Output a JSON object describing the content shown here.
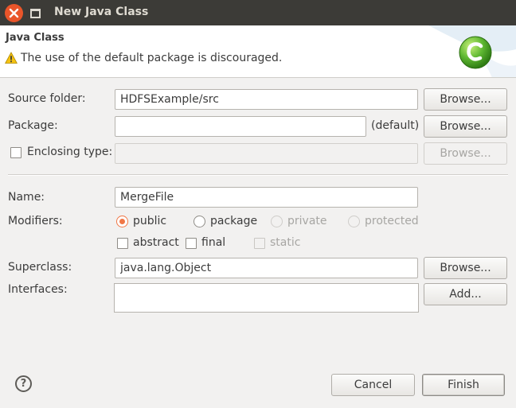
{
  "window": {
    "title": "New Java Class"
  },
  "header": {
    "title": "Java Class",
    "message": "The use of the default package is discouraged.",
    "icon": "java-class-logo-icon",
    "accent": "#5fb832"
  },
  "form": {
    "source_folder": {
      "label": "Source folder:",
      "value": "HDFSExample/src",
      "browse_label": "Browse..."
    },
    "package": {
      "label": "Package:",
      "value": "",
      "suffix": "(default)",
      "browse_label": "Browse..."
    },
    "enclosing_type": {
      "label": "Enclosing type:",
      "value": "",
      "browse_label": "Browse..."
    },
    "name": {
      "label": "Name:",
      "value": "MergeFile"
    },
    "modifiers": {
      "label": "Modifiers:",
      "options": [
        "public",
        "package",
        "private",
        "protected"
      ],
      "selected": "public",
      "checks": [
        "abstract",
        "final",
        "static"
      ]
    },
    "superclass": {
      "label": "Superclass:",
      "value": "java.lang.Object",
      "browse_label": "Browse..."
    },
    "interfaces": {
      "label": "Interfaces:",
      "add_label": "Add..."
    }
  },
  "footer": {
    "help_icon": "help-icon",
    "cancel_label": "Cancel",
    "finish_label": "Finish"
  }
}
